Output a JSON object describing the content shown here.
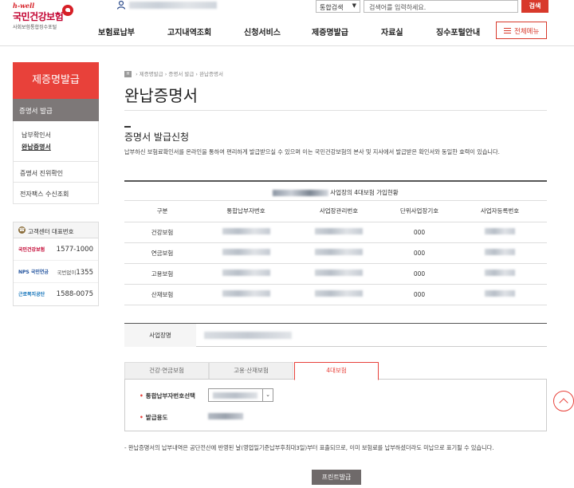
{
  "header": {
    "logo_tag": "h-well",
    "logo_name": "국민건강보험",
    "logo_sub": "사회보험통합징수포털",
    "search_scope": "통합검색",
    "search_placeholder": "검색어를 입력하세요.",
    "search_button": "검색",
    "nav": [
      "보험료납부",
      "고지내역조회",
      "신청서비스",
      "제증명발급",
      "자료실",
      "징수포털안내"
    ],
    "menu_button": "전체메뉴"
  },
  "sidebar": {
    "title": "제증명발급",
    "section": "증명서 발급",
    "links": [
      "납부확인서",
      "완납증명서"
    ],
    "items": [
      "증명서 진위확인",
      "전자팩스 수신조회"
    ],
    "center_title": "고객센터 대표번호",
    "centers": [
      {
        "org": "국민건강보험",
        "number": "1577-1000",
        "prefix": ""
      },
      {
        "org": "NPS 국민연금",
        "number": "1355",
        "prefix": "국번없이"
      },
      {
        "org": "근로복지공단",
        "number": "1588-0075",
        "prefix": ""
      }
    ]
  },
  "main": {
    "breadcrumb": [
      "제증명발급",
      "증명서 발급",
      "완납증명서"
    ],
    "page_title": "완납증명서",
    "section_title": "증명서 발급신청",
    "description": "납부하신 보험료확인서를 온라인을 통하여 편리하게 발급받으실 수 있으며 이는 국민건강보험의 본사 및 지사에서 발급받은 확인서와 동일한 효력이 있습니다.",
    "table_caption_suffix": "사업장의 4대보험 가입현황",
    "columns": [
      "구분",
      "통합납부자번호",
      "사업장관리번호",
      "단위사업장기호",
      "사업자등록번호"
    ],
    "rows": [
      {
        "type": "건강보험",
        "unit": "000"
      },
      {
        "type": "연금보험",
        "unit": "000"
      },
      {
        "type": "고용보험",
        "unit": "000"
      },
      {
        "type": "산재보험",
        "unit": "000"
      }
    ],
    "biz_label": "사업장명",
    "tabs": [
      "건강·연금보험",
      "고용·산재보험",
      "4대보험"
    ],
    "active_tab": 2,
    "form": {
      "payer_label": "통합납부자번호선택",
      "purpose_label": "발급용도"
    },
    "note": "- 완납증명서의 납부내역은 공단전산에 반영된 날(영업일기준납부후최대3일)부터 표출되므로, 이미 보험료를 납부하셨더라도 미납으로 표기될 수 있습니다.",
    "print_button": "프린트발급"
  }
}
